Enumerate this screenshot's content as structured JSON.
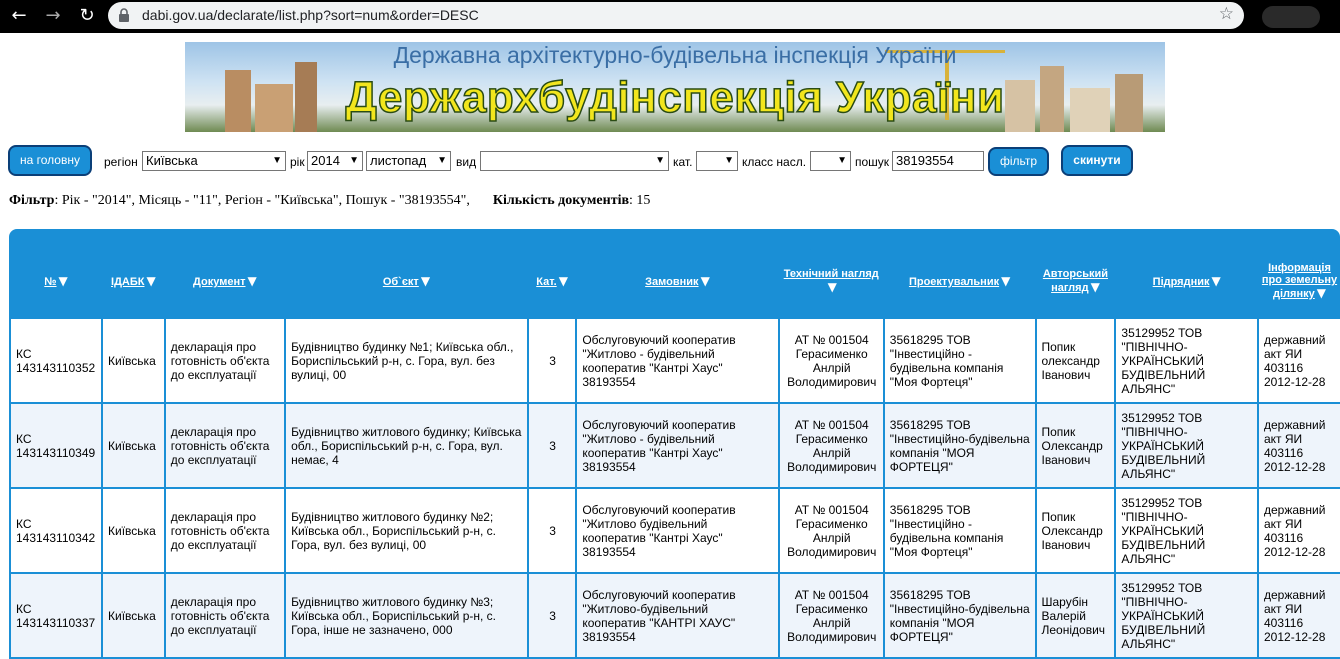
{
  "browser": {
    "url": "dabi.gov.ua/declarate/list.php?sort=num&order=DESC"
  },
  "banner": {
    "subtitle": "Державна архітектурно-будівельна інспекція України",
    "title": "Держархбудінспекція України"
  },
  "filters": {
    "home_label": "на головну",
    "region_label": "регіон",
    "region_value": "Київська",
    "year_label": "рік",
    "year_value": "2014",
    "month_value": "листопад",
    "type_label": "вид",
    "type_value": "",
    "cat_label": "кат.",
    "cat_value": "",
    "class_label": "класс насл.",
    "class_value": "",
    "search_label": "пошук",
    "search_value": "38193554",
    "filter_button": "фільтр",
    "reset_button": "скинути"
  },
  "summary": {
    "filter_label": "Фільтр",
    "filter_text": ": Рік - \"2014\", Місяць - \"11\", Регіон - \"Київська\", Пошук - \"38193554\",",
    "count_label": "Кількість документів",
    "count_value": ": 15"
  },
  "table": {
    "headers": [
      "№",
      "ІДАБК",
      "Документ",
      "Об`єкт",
      "Кат.",
      "Замовник",
      "Технічний нагляд",
      "Проектувальник",
      "Авторський нагляд",
      "Підрядник",
      "Інформація про земельну ділянку"
    ],
    "rows": [
      [
        "КС 143143110352",
        "Київська",
        "декларація про готовність об'єкта до експлуатації",
        "Будівництво будинку №1; Київська обл., Бориспільський р-н, с. Гора, вул. без вулиці, 00",
        "3",
        "Обслуговуючий кооператив \"Житлово - будівельний кооператив \"Кантрі Хаус\" 38193554",
        "АТ № 001504 Герасименко Анлрій Володимирович",
        "35618295 ТОВ \"Інвестиційно - будівельна компанія \"Моя Фортеця\"",
        "Попик олександр Іванович",
        "35129952 ТОВ \"ПІВНІЧНО-УКРАЇНСЬКИЙ БУДІВЕЛЬНИЙ АЛЬЯНС\"",
        "державний акт ЯИ 403116 2012-12-28"
      ],
      [
        "КС 143143110349",
        "Київська",
        "декларація про готовність об'єкта до експлуатації",
        "Будівництво житлового будинку; Київська обл., Бориспільський р-н, с. Гора, вул. немає, 4",
        "3",
        "Обслуговуючий кооператив \"Житлово - будівельний кооператив \"Кантрі Хаус\" 38193554",
        "АТ № 001504 Герасименко Анлрій Володимирович",
        "35618295 ТОВ \"Інвестиційно-будівельна компанія \"МОЯ ФОРТЕЦЯ\"",
        "Попик Олександр Іванович",
        "35129952 ТОВ \"ПІВНІЧНО-УКРАЇНСЬКИЙ БУДІВЕЛЬНИЙ АЛЬЯНС\"",
        "державний акт ЯИ 403116 2012-12-28"
      ],
      [
        "КС 143143110342",
        "Київська",
        "декларація про готовність об'єкта до експлуатації",
        "Будівництво житлового будинку №2; Київська обл., Бориспільський р-н, с. Гора, вул. без вулиці, 00",
        "3",
        "Обслуговуючий кооператив \"Житлово будівельний кооператив \"Кантрі Хаус\" 38193554",
        "АТ № 001504 Герасименко Анлрій Володимирович",
        "35618295 ТОВ \"Інвестиційно - будівельна компанія \"Моя Фортеця\"",
        "Попик Олександр Іванович",
        "35129952 ТОВ \"ПІВНІЧНО-УКРАЇНСЬКИЙ БУДІВЕЛЬНИЙ АЛЬЯНС\"",
        "державний акт ЯИ 403116 2012-12-28"
      ],
      [
        "КС 143143110337",
        "Київська",
        "декларація про готовність об'єкта до експлуатації",
        "Будівництво житлового будинку №3; Київська обл., Бориспільський р-н, с. Гора, інше не зазначено, 000",
        "3",
        "Обслуговуючий кооператив \"Житлово-будівельний кооператив \"КАНТРІ ХАУС\" 38193554",
        "АТ № 001504 Герасименко Анлрій Володимирович",
        "35618295 ТОВ \"Інвестиційно-будівельна компанія \"МОЯ ФОРТЕЦЯ\"",
        "Шарубін Валерій Леонідович",
        "35129952 ТОВ \"ПІВНІЧНО-УКРАЇНСЬКИЙ БУДІВЕЛЬНИЙ АЛЬЯНС\"",
        "державний акт ЯИ 403116 2012-12-28"
      ]
    ]
  },
  "icons": {
    "back": "back-arrow-icon",
    "forward": "forward-arrow-icon",
    "reload": "reload-icon",
    "lock": "lock-icon",
    "star": "star-icon",
    "sort": "sort-down-triangle-icon"
  },
  "colors": {
    "accent": "#1a8fd6",
    "button_border": "#0b3f78",
    "row_alt": "#eef4fb"
  }
}
